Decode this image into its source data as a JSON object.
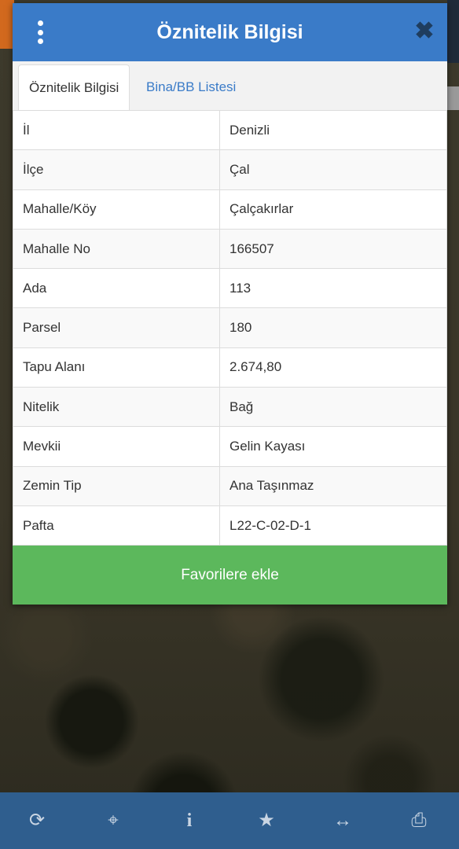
{
  "modal": {
    "title": "Öznitelik Bilgisi",
    "menu_icon": "kebab-menu-icon",
    "close_icon": "close-icon",
    "close_glyph": "✖",
    "header_color": "#3a7bc8"
  },
  "tabs": [
    {
      "label": "Öznitelik Bilgisi",
      "active": true
    },
    {
      "label": "Bina/BB Listesi",
      "active": false
    }
  ],
  "attributes": [
    {
      "key": "İl",
      "value": "Denizli"
    },
    {
      "key": "İlçe",
      "value": "Çal"
    },
    {
      "key": "Mahalle/Köy",
      "value": "Çalçakırlar"
    },
    {
      "key": "Mahalle No",
      "value": "166507"
    },
    {
      "key": "Ada",
      "value": "113"
    },
    {
      "key": "Parsel",
      "value": "180"
    },
    {
      "key": "Tapu Alanı",
      "value": "2.674,80"
    },
    {
      "key": "Nitelik",
      "value": "Bağ"
    },
    {
      "key": "Mevkii",
      "value": "Gelin Kayası"
    },
    {
      "key": "Zemin Tip",
      "value": "Ana Taşınmaz"
    },
    {
      "key": "Pafta",
      "value": "L22-C-02-D-1"
    }
  ],
  "favorite_button": {
    "label": "Favorilere ekle",
    "color": "#5cb85c"
  },
  "bottom_toolbar": {
    "icons": [
      {
        "name": "refresh-icon",
        "glyph": "⟳"
      },
      {
        "name": "locate-icon",
        "glyph": "⌖"
      },
      {
        "name": "info-icon",
        "glyph": "i"
      },
      {
        "name": "star-icon",
        "glyph": "★"
      },
      {
        "name": "measure-icon",
        "glyph": "↔"
      },
      {
        "name": "print-icon",
        "glyph": "⎙"
      }
    ],
    "color": "#2f5e8e"
  }
}
